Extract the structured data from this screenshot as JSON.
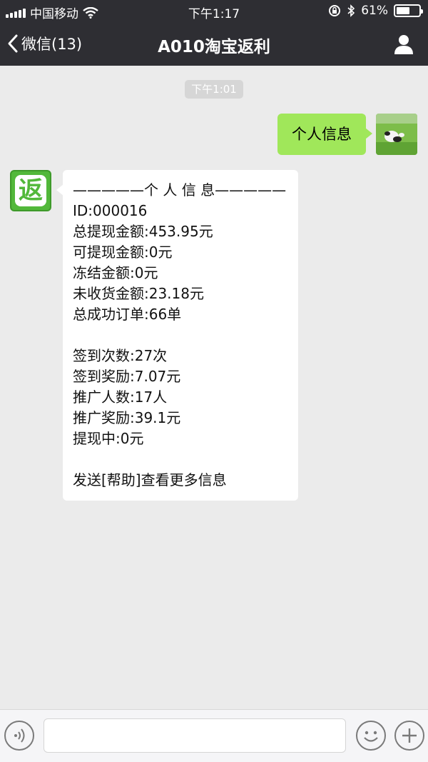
{
  "status_bar": {
    "carrier": "中国移动",
    "time": "下午1:17",
    "battery": "61%",
    "battery_level": 0.61
  },
  "nav": {
    "back_label": "微信(13)",
    "title": "A010淘宝返利"
  },
  "chat": {
    "timestamp": "下午1:01",
    "sent_message": "个人信息",
    "bot_avatar_char": "返",
    "reply_lines": [
      "—————个 人 信 息—————",
      "ID:000016",
      "总提现金额:453.95元",
      "可提现金额:0元",
      "冻结金额:0元",
      "未收货金额:23.18元",
      "总成功订单:66单",
      "",
      "签到次数:27次",
      "签到奖励:7.07元",
      "推广人数:17人",
      "推广奖励:39.1元",
      "提现中:0元",
      "",
      "发送[帮助]查看更多信息"
    ]
  },
  "icons": {
    "signal": "signal-icon",
    "wifi": "wifi-icon",
    "lock_rotation": "rotation-lock-icon",
    "bluetooth": "bluetooth-icon",
    "battery": "battery-icon",
    "back": "chevron-left-icon",
    "contact": "person-icon",
    "voice": "voice-icon",
    "emoji": "emoji-icon",
    "plus": "plus-icon"
  },
  "colors": {
    "bar": "#2e2e33",
    "background": "#ebebeb",
    "sent_bubble": "#a0e75a",
    "received_bubble": "#ffffff",
    "bot_green": "#52b83a"
  }
}
